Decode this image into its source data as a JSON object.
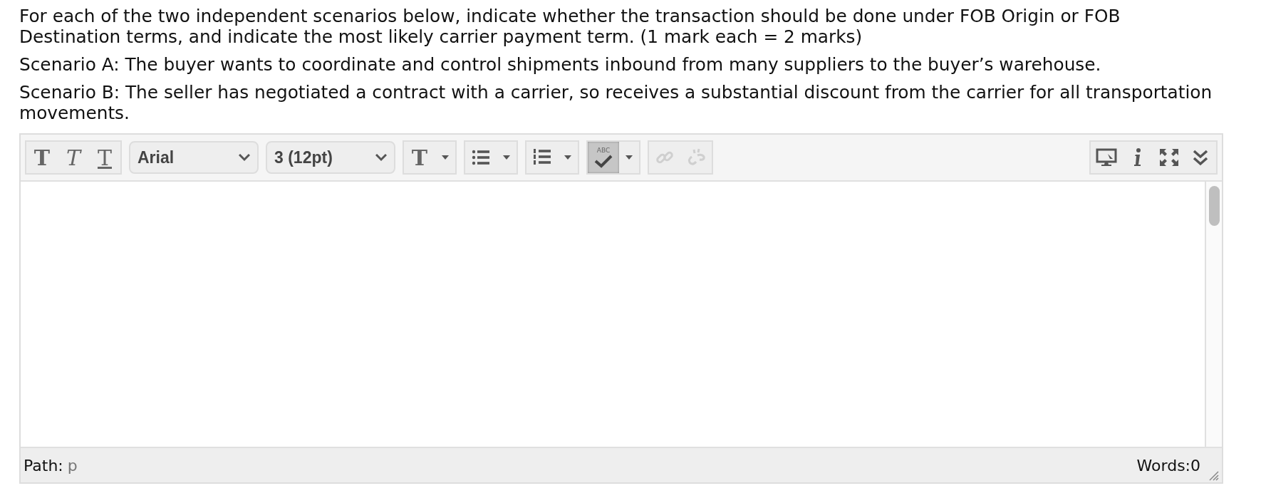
{
  "question": {
    "prompt": "For each of the two independent scenarios below, indicate whether the transaction should be done under FOB Origin or FOB Destination terms, and indicate the most likely carrier payment term.  (1 mark each = 2 marks)",
    "scenarios": [
      "Scenario A: The buyer wants to coordinate and control shipments inbound from many suppliers to the buyer’s warehouse.",
      "Scenario B: The seller has negotiated a contract with a carrier, so receives a substantial discount from the carrier for all transportation movements."
    ]
  },
  "editor": {
    "toolbar": {
      "format_buttons": [
        {
          "kind": "bold",
          "label": "T"
        },
        {
          "kind": "italic",
          "label": "T"
        },
        {
          "kind": "underline",
          "label": "T"
        }
      ],
      "font": "Arial",
      "size": "3 (12pt)",
      "split_buttons": [
        {
          "kind": "text-color",
          "label": "T"
        },
        {
          "kind": "bullet-list"
        },
        {
          "kind": "numbered-list"
        },
        {
          "kind": "spellcheck",
          "label": "ABC",
          "on": true
        }
      ],
      "link_buttons": [
        {
          "kind": "link",
          "disabled": true
        },
        {
          "kind": "unlink",
          "disabled": true
        }
      ],
      "right_buttons": [
        {
          "kind": "preview"
        },
        {
          "kind": "info"
        },
        {
          "kind": "fullscreen"
        },
        {
          "kind": "more"
        }
      ]
    },
    "path_label": "Path:",
    "path_value": "p",
    "word_count": "Words:0"
  }
}
